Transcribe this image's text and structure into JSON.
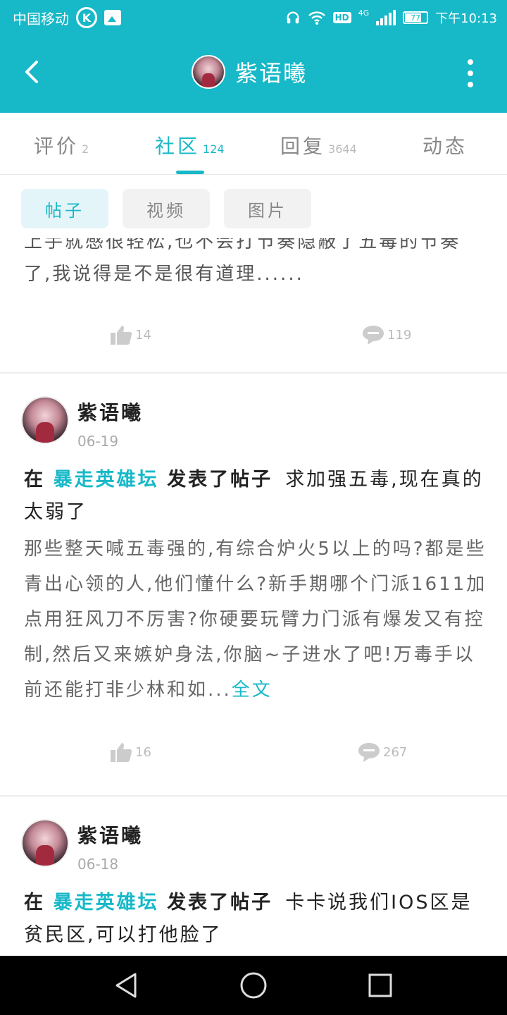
{
  "status_bar": {
    "carrier": "中国移动",
    "network": "4G",
    "hd_label": "HD",
    "battery": "77",
    "time": "下午10:13",
    "icons": [
      "k-app-icon",
      "image-icon",
      "headset-icon",
      "wifi-icon",
      "signal-icon",
      "battery-icon"
    ]
  },
  "header": {
    "title": "紫语曦",
    "back_icon": "chevron-left-icon",
    "more_icon": "more-vertical-icon"
  },
  "tabs": [
    {
      "label": "评价",
      "count": "2",
      "active": false
    },
    {
      "label": "社区",
      "count": "124",
      "active": true
    },
    {
      "label": "回复",
      "count": "3644",
      "active": false
    },
    {
      "label": "动态",
      "count": "",
      "active": false
    }
  ],
  "filters": [
    {
      "label": "帖子",
      "active": true
    },
    {
      "label": "视频",
      "active": false
    },
    {
      "label": "图片",
      "active": false
    }
  ],
  "posts": [
    {
      "partial_text": "上手就感很轻松,也不会打节奏隐蔽了五毒的节奏了,我说得是不是很有道理......",
      "likes": "14",
      "comments": "119"
    },
    {
      "author": "紫语曦",
      "date": "06-19",
      "prefix": "在",
      "forum": "暴走英雄坛",
      "action": "发表了帖子",
      "title": "求加强五毒,现在真的太弱了",
      "excerpt": "那些整天喊五毒强的,有综合炉火5以上的吗?都是些青出心领的人,他们懂什么?新手期哪个门派1611加点用狂风刀不厉害?你硬要玩臂力门派有爆发又有控制,然后又来嫉妒身法,你脑~子进水了吧!万毒手以前还能打非少林和如...",
      "more_label": "全文",
      "likes": "16",
      "comments": "267"
    },
    {
      "author": "紫语曦",
      "date": "06-18",
      "prefix": "在",
      "forum": "暴走英雄坛",
      "action": "发表了帖子",
      "title": "卡卡说我们IOS区是贫民区,可以打他脸了"
    }
  ],
  "navbar": {
    "icons": [
      "back-triangle-icon",
      "home-circle-icon",
      "recents-square-icon"
    ]
  },
  "colors": {
    "accent": "#17b8c8",
    "chip_active_bg": "#e4f5f9",
    "navbar": "#000000"
  }
}
